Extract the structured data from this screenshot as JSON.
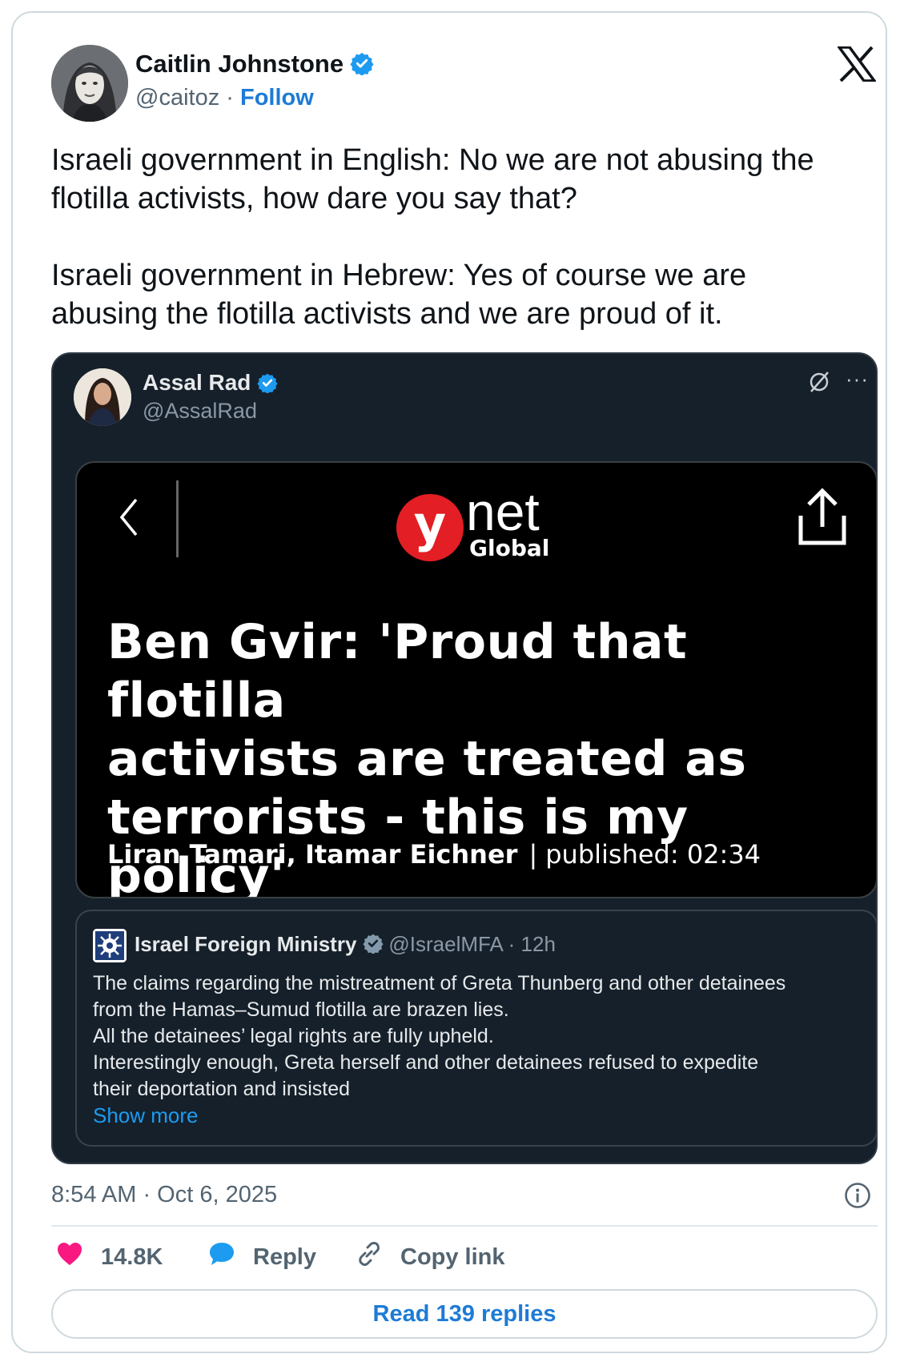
{
  "colors": {
    "link": "#1d7bd6",
    "verified": "#1d9bf0",
    "like": "#f91880",
    "embed_bg": "#15202b",
    "ynet_red": "#e31e24"
  },
  "author": {
    "name": "Caitlin Johnstone",
    "handle": "@caitoz",
    "separator": "·",
    "follow_label": "Follow",
    "verified": true,
    "avatar_icon": "avatar-sketch"
  },
  "platform_icon": "x-logo-icon",
  "tweet": {
    "paragraphs": [
      "Israeli government in English: No we are not abusing the flotilla activists, how dare you say that?",
      "Israeli government in Hebrew: Yes of course we are abusing the flotilla activists and we are proud of it."
    ],
    "timestamp": "8:54 AM · Oct 6, 2025"
  },
  "embedded": {
    "author_name": "Assal Rad",
    "author_handle": "@AssalRad",
    "verified": true,
    "more_label": "···",
    "article_card": {
      "logo_letter": "y",
      "logo_word": "net",
      "logo_sub": "Global",
      "headline_lines": [
        "Ben Gvir: 'Proud that flotilla",
        "activists are treated as",
        "terrorists - this is my policy'"
      ],
      "byline": "Liran Tamari, Itamar Eichner",
      "published": "published: 02:34"
    },
    "quoted": {
      "name": "Israel Foreign Ministry",
      "handle": "@IsraelMFA",
      "separator": "·",
      "age": "12h",
      "text_lines": [
        "The claims regarding the mistreatment of Greta Thunberg and other detainees",
        "from the Hamas–Sumud flotilla are brazen lies.",
        "All the detainees’ legal rights are fully upheld.",
        "Interestingly enough, Greta herself and other detainees refused to expedite",
        "their deportation and insisted"
      ],
      "show_more": "Show more"
    }
  },
  "actions": {
    "likes": "14.8K",
    "reply": "Reply",
    "copy_link": "Copy link"
  },
  "read_replies": "Read 139 replies"
}
